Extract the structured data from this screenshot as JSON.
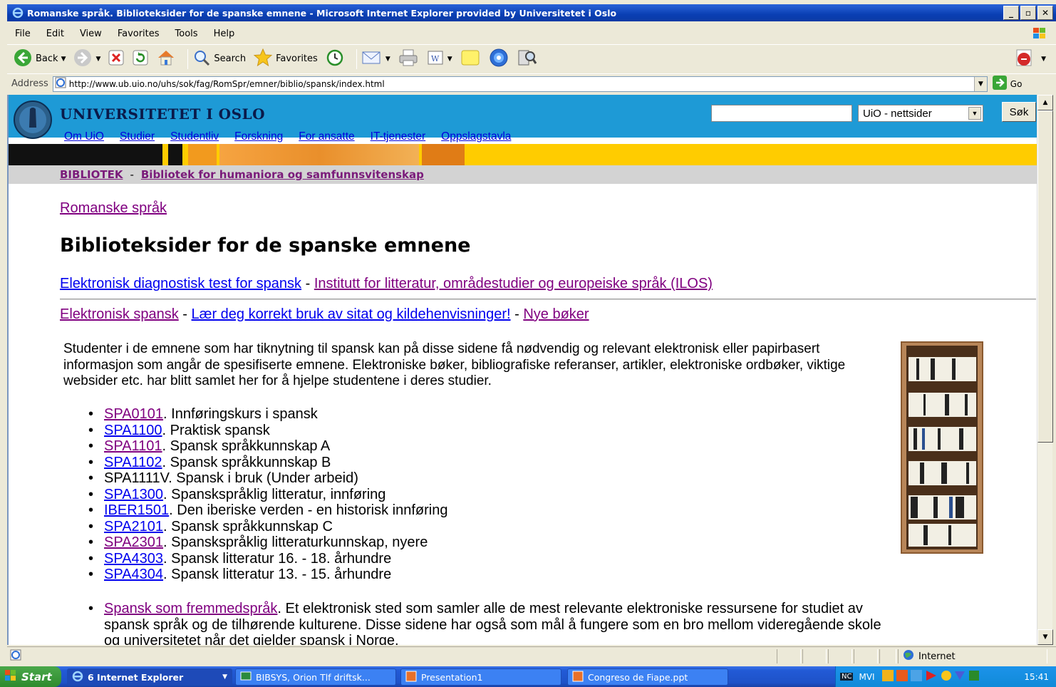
{
  "window": {
    "title": "Romanske språk. Biblioteksider for de spanske emnene - Microsoft Internet Explorer provided by Universitetet i Oslo"
  },
  "menu": [
    "File",
    "Edit",
    "View",
    "Favorites",
    "Tools",
    "Help"
  ],
  "toolbar": {
    "back": "Back",
    "search": "Search",
    "favorites": "Favorites"
  },
  "address": {
    "label": "Address",
    "url": "http://www.ub.uio.no/uhs/sok/fag/RomSpr/emner/biblio/spansk/index.html",
    "go": "Go"
  },
  "uio": {
    "name": "UNIVERSITETET I OSLO",
    "search_scope": "UiO - nettsider",
    "search_button": "Søk",
    "nav": [
      "Om UiO",
      "Studier",
      "Studentliv",
      "Forskning",
      "For ansatte",
      "IT-tjenester",
      "Oppslagstavla"
    ]
  },
  "libbar": {
    "item1": "BIBLIOTEK",
    "sep": "-",
    "item2": "Bibliotek for humaniora og samfunnsvitenskap"
  },
  "page": {
    "breadcrumb": "Romanske språk",
    "title": "Biblioteksider for de spanske emnene",
    "links1": {
      "a": "Elektronisk diagnostisk test for spansk",
      "sep": " - ",
      "b": "Institutt for litteratur, områdestudier og europeiske språk (ILOS)"
    },
    "links2": {
      "a": "Elektronisk spansk",
      "sep1": " - ",
      "b": "Lær deg korrekt bruk av sitat og kildehenvisninger!",
      "sep2": " - ",
      "c": "Nye bøker"
    },
    "intro": "Studenter i de emnene som har tiknytning til spansk kan på disse sidene få nødvendig og relevant elektronisk eller papirbasert informasjon som angår de spesifiserte emnene. Elektroniske bøker, bibliografiske referanser, artikler, elektroniske ordbøker, viktige websider etc. har blitt samlet her for å hjelpe studentene i deres studier.",
    "courses": [
      {
        "code": "SPA0101",
        "text": ". Innføringskurs i spansk",
        "link": true,
        "visited": true
      },
      {
        "code": "SPA1100",
        "text": ". Praktisk spansk",
        "link": true,
        "visited": false
      },
      {
        "code": "SPA1101",
        "text": ". Spansk språkkunnskap A",
        "link": true,
        "visited": true
      },
      {
        "code": "SPA1102",
        "text": ". Spansk språkkunnskap B",
        "link": true,
        "visited": false
      },
      {
        "code": "SPA1111V",
        "text": ". Spansk i bruk (Under arbeid)",
        "link": false,
        "visited": false
      },
      {
        "code": "SPA1300",
        "text": ". Spanskspråklig litteratur, innføring",
        "link": true,
        "visited": false
      },
      {
        "code": "IBER1501",
        "text": ". Den iberiske verden - en historisk innføring",
        "link": true,
        "visited": false
      },
      {
        "code": "SPA2101",
        "text": ". Spansk språkkunnskap C",
        "link": true,
        "visited": false
      },
      {
        "code": "SPA2301",
        "text": ". Spanskspråklig litteraturkunnskap, nyere",
        "link": true,
        "visited": true
      },
      {
        "code": "SPA4303",
        "text": ". Spansk litteratur 16. - 18. århundre",
        "link": true,
        "visited": false
      },
      {
        "code": "SPA4304",
        "text": ". Spansk litteratur 13. - 15. århundre",
        "link": true,
        "visited": false
      }
    ],
    "more": {
      "link": "Spansk som fremmedspråk",
      "text": ". Et elektronisk sted som samler alle de mest relevante elektroniske ressursene for studiet av spansk språk og de tilhørende kulturene. Disse sidene har også som mål å fungere som en bro mellom videregående skole og universitetet når det gjelder spansk i Norge."
    }
  },
  "status": {
    "zone": "Internet"
  },
  "taskbar": {
    "start": "Start",
    "tasks": [
      "6 Internet Explorer",
      "BIBSYS, Orion Tlf driftsk...",
      "Presentation1",
      "Congreso de Fiape.ppt"
    ],
    "tray_text": "MVI",
    "clock": "15:41"
  },
  "colors": {
    "uio_blue": "#1e9ad6",
    "banner_yellow": "#ffcc00",
    "link_unvisited": "#0000ee",
    "link_visited": "#800080"
  }
}
